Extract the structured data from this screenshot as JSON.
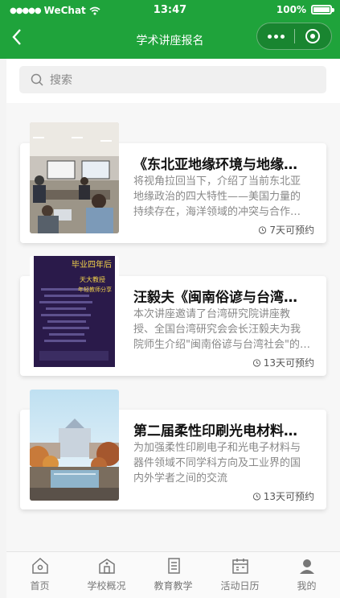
{
  "status_bar": {
    "carrier": "WeChat",
    "time": "13:47",
    "battery": "100%"
  },
  "nav": {
    "title": "学术讲座报名"
  },
  "search": {
    "placeholder": "搜索"
  },
  "lectures": [
    {
      "title": "《东北亚地缘环境与地缘政治》",
      "desc": "将视角拉回当下，介绍了当前东北亚地缘政治的四大特性——美国力量的持续存在，海洋领域的冲突与合作，以及区域秩序的演变。",
      "badge": "7天可预约",
      "image": "meeting-room-photo"
    },
    {
      "title": "汪毅夫《闽南俗谚与台湾社会》",
      "desc": "本次讲座邀请了台湾研究院讲座教授、全国台湾研究会会长汪毅夫为我院师生介绍\"闽南俗谚与台湾社会\"的相关内容。",
      "badge": "13天可预约",
      "image": "book-poster",
      "poster_text": [
        "毕业四年后",
        "天大教授",
        "年轻教师分享"
      ]
    },
    {
      "title": "第二届柔性印刷光电材料与器件研讨会",
      "desc": "为加强柔性印刷电子和光电子材料与器件领域不同学科方向及工业界的国内外学者之间的交流",
      "badge": "13天可预约",
      "image": "campus-building-photo"
    }
  ],
  "tabbar": {
    "items": [
      {
        "label": "首页",
        "icon": "home-icon"
      },
      {
        "label": "学校概况",
        "icon": "school-icon"
      },
      {
        "label": "教育教学",
        "icon": "book-icon"
      },
      {
        "label": "活动日历",
        "icon": "calendar-icon"
      },
      {
        "label": "我的",
        "icon": "user-icon"
      }
    ]
  },
  "colors": {
    "brand": "#1fa33b",
    "text_muted": "#888888"
  }
}
